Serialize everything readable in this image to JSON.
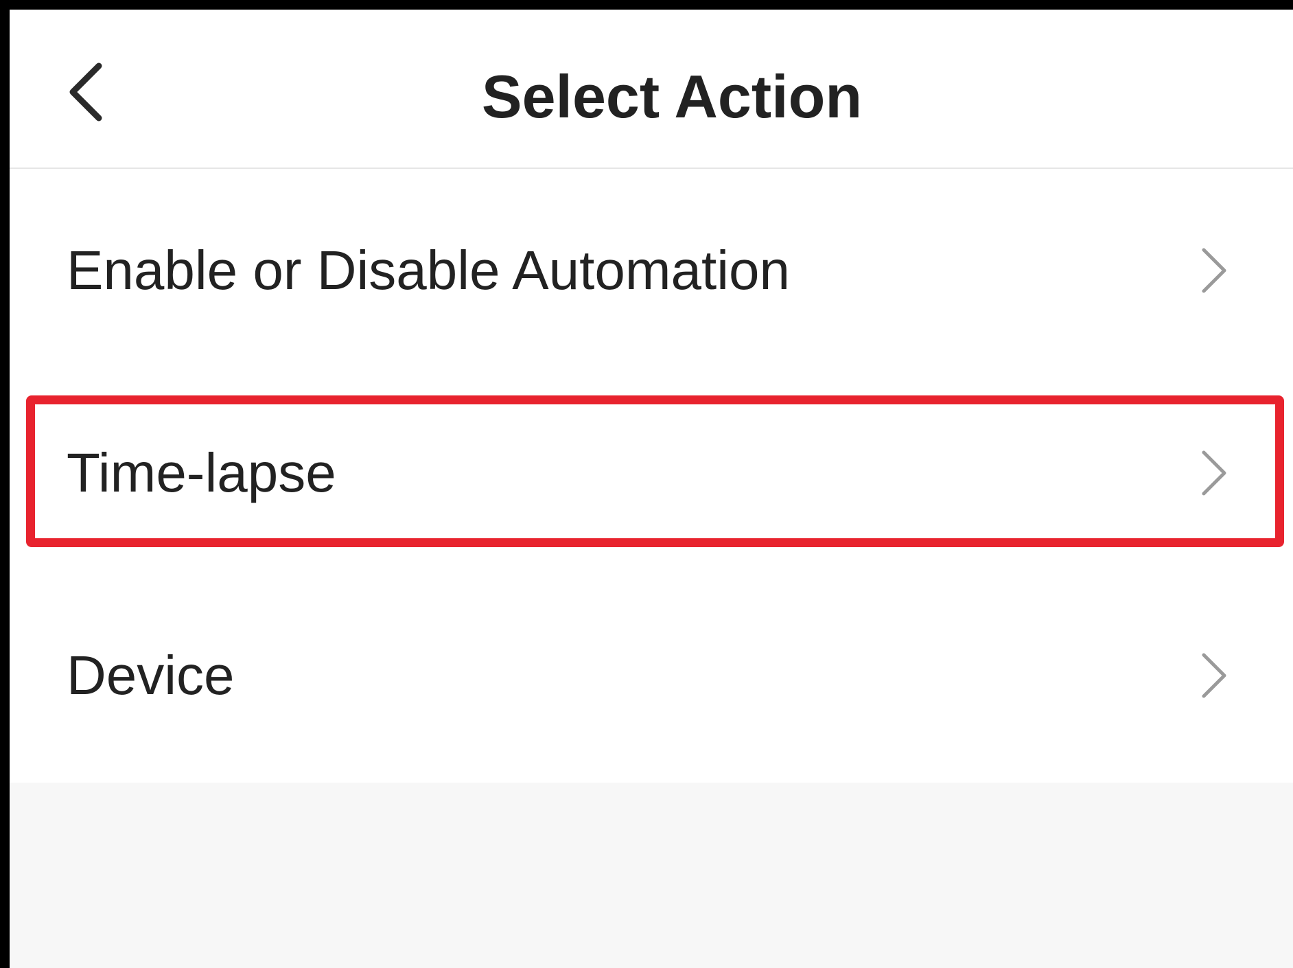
{
  "header": {
    "title": "Select Action",
    "back_icon": "chevron-left-icon"
  },
  "actions": [
    {
      "label": "Enable or Disable Automation",
      "icon": "chevron-right-icon"
    },
    {
      "label": "Time-lapse",
      "icon": "chevron-right-icon",
      "highlighted": true
    },
    {
      "label": "Device",
      "icon": "chevron-right-icon"
    }
  ],
  "colors": {
    "highlight": "#e8232e",
    "text": "#222222",
    "chevron": "#9a9a9a",
    "background": "#ffffff",
    "footer_background": "#f7f7f7"
  }
}
